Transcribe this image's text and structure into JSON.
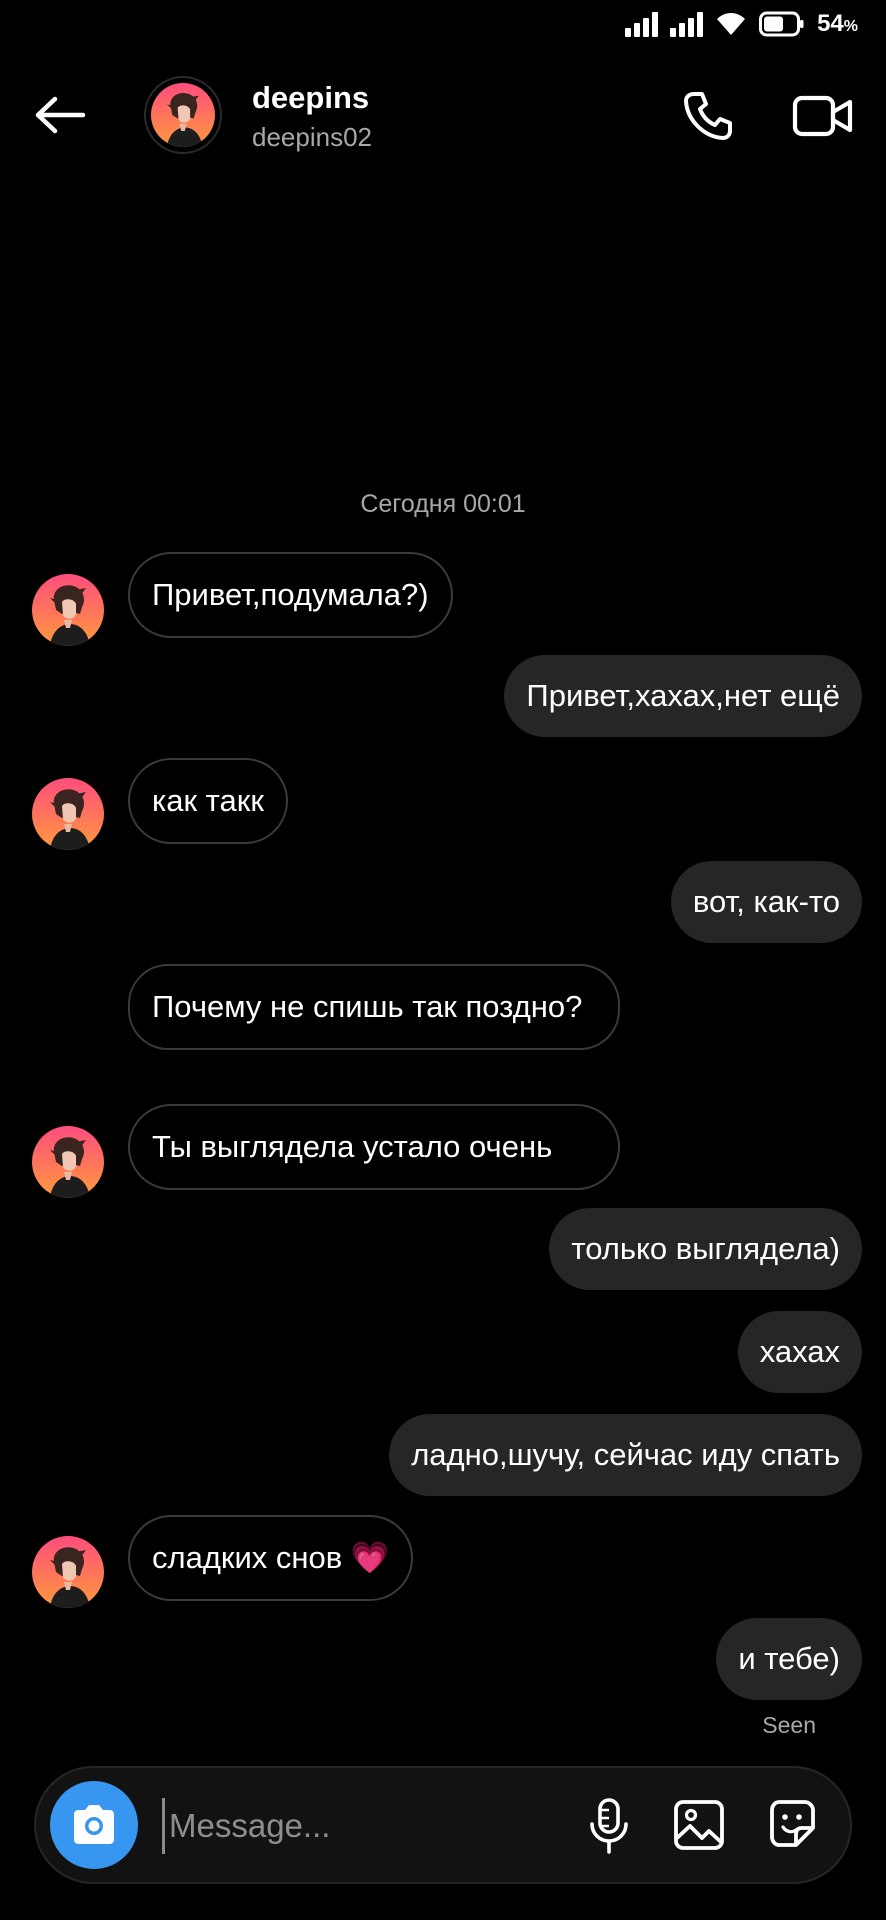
{
  "status_bar": {
    "battery_percent": "54",
    "battery_unit": "%"
  },
  "header": {
    "name": "deepins",
    "username": "deepins02",
    "icons": {
      "back": "back-arrow-icon",
      "call": "phone-icon",
      "video": "video-camera-icon"
    }
  },
  "chat": {
    "timestamp": "Сегодня 00:01",
    "messages": [
      {
        "direction": "incoming",
        "text": "Привет,подумала?)"
      },
      {
        "direction": "outgoing",
        "text": "Привет,хахах,нет ещё"
      },
      {
        "direction": "incoming",
        "text": "как такк"
      },
      {
        "direction": "outgoing",
        "text": "вот, как-то"
      },
      {
        "direction": "incoming",
        "text": "Почему не спишь так поздно?"
      },
      {
        "direction": "incoming",
        "text": "Ты выглядела устало очень"
      },
      {
        "direction": "outgoing",
        "text": "только выглядела)"
      },
      {
        "direction": "outgoing",
        "text": "хахах"
      },
      {
        "direction": "outgoing",
        "text": "ладно,шучу, сейчас иду спать"
      },
      {
        "direction": "incoming",
        "text": "сладких снов",
        "emoji": "💗"
      },
      {
        "direction": "outgoing",
        "text": "и тебе)"
      }
    ],
    "seen_label": "Seen"
  },
  "composer": {
    "placeholder": "Message...",
    "icons": {
      "camera": "camera-icon",
      "mic": "microphone-icon",
      "gallery": "gallery-icon",
      "sticker": "sticker-icon"
    }
  },
  "colors": {
    "background": "#000000",
    "outgoing_bubble": "#262626",
    "incoming_border": "#3a3a3a",
    "secondary_text": "#a8a8a8",
    "camera_button": "#3797f0"
  }
}
